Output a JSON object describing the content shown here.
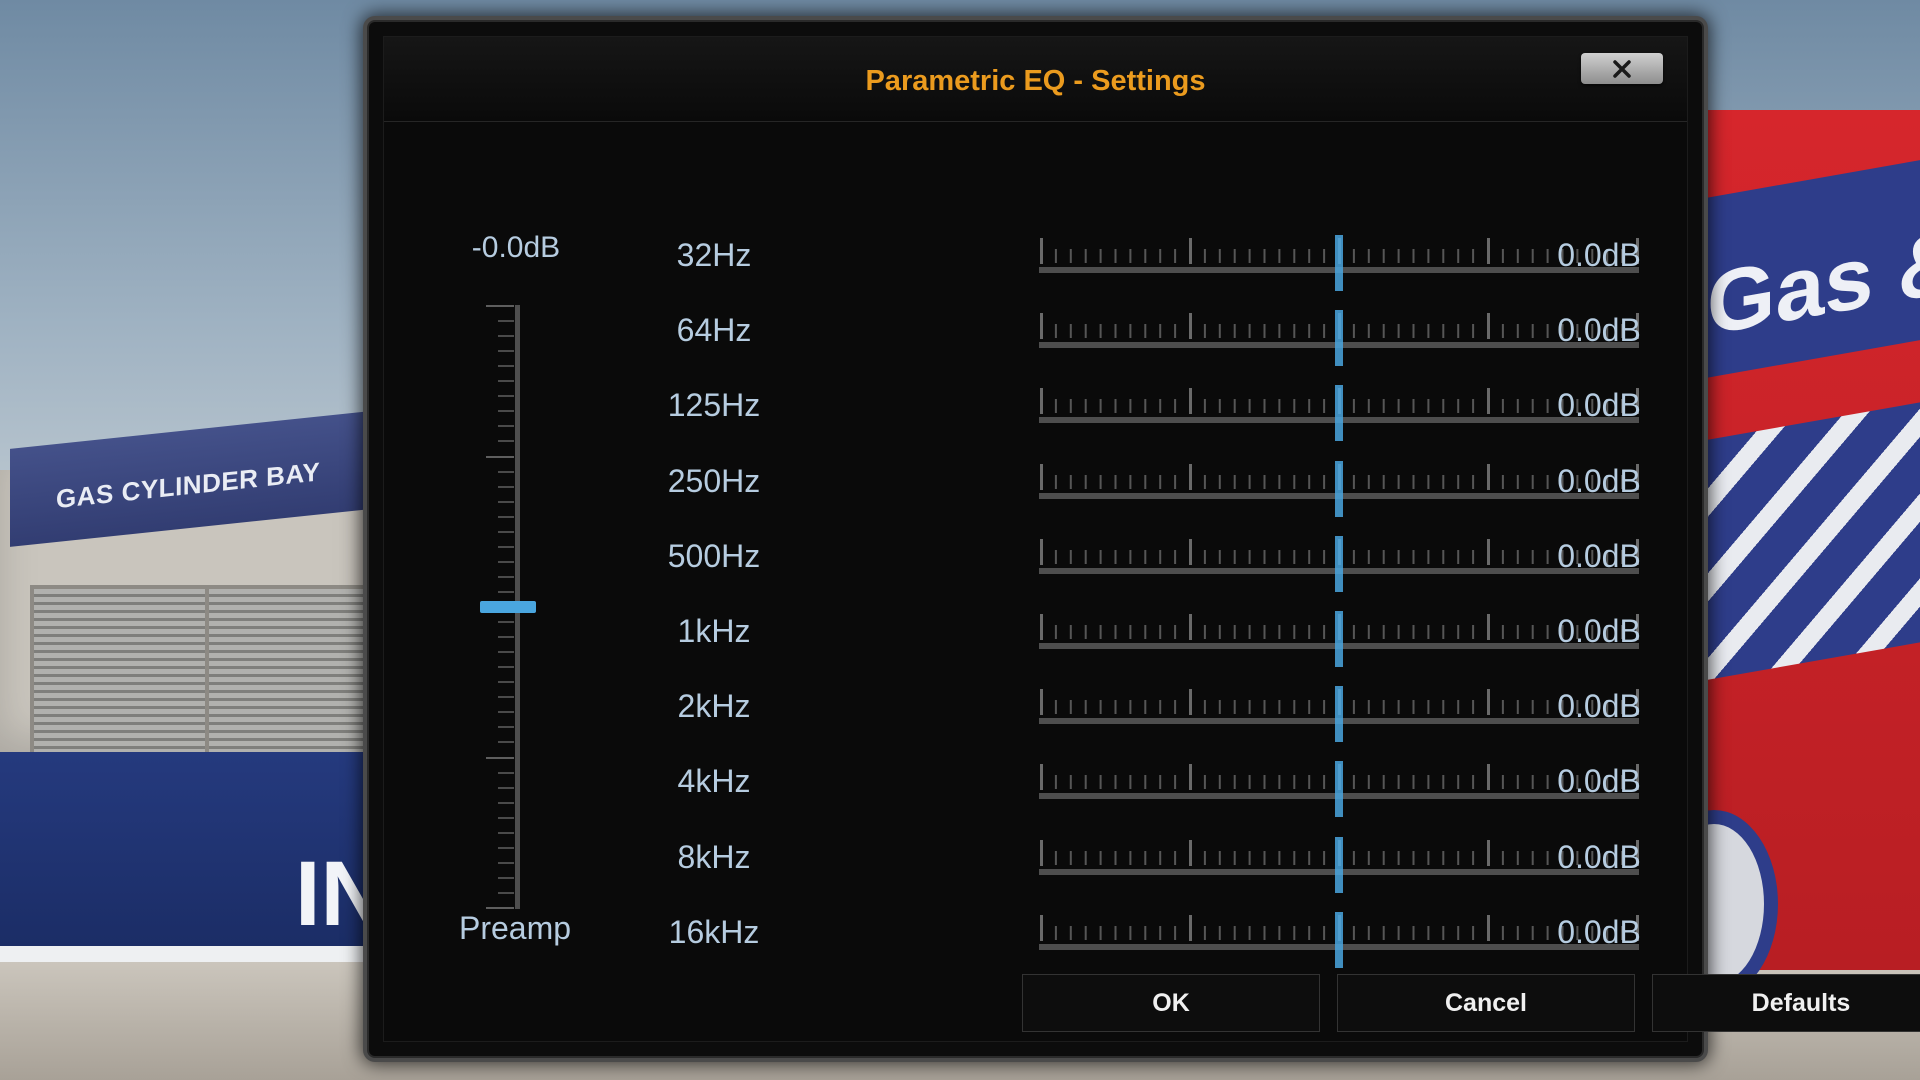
{
  "background": {
    "sign_left": "GAS CYLINDER BAY",
    "wall_text": "IN",
    "sign_right": "Gas &"
  },
  "dialog": {
    "title": "Parametric EQ - Settings",
    "close_icon": "close-icon"
  },
  "preamp": {
    "value": "-0.0dB",
    "label": "Preamp",
    "level_fraction": 0.5
  },
  "bands": [
    {
      "freq": "32Hz",
      "gain": "0.0dB",
      "level_fraction": 0.5
    },
    {
      "freq": "64Hz",
      "gain": "0.0dB",
      "level_fraction": 0.5
    },
    {
      "freq": "125Hz",
      "gain": "0.0dB",
      "level_fraction": 0.5
    },
    {
      "freq": "250Hz",
      "gain": "0.0dB",
      "level_fraction": 0.5
    },
    {
      "freq": "500Hz",
      "gain": "0.0dB",
      "level_fraction": 0.5
    },
    {
      "freq": "1kHz",
      "gain": "0.0dB",
      "level_fraction": 0.5
    },
    {
      "freq": "2kHz",
      "gain": "0.0dB",
      "level_fraction": 0.5
    },
    {
      "freq": "4kHz",
      "gain": "0.0dB",
      "level_fraction": 0.5
    },
    {
      "freq": "8kHz",
      "gain": "0.0dB",
      "level_fraction": 0.5
    },
    {
      "freq": "16kHz",
      "gain": "0.0dB",
      "level_fraction": 0.5
    }
  ],
  "buttons": {
    "ok": "OK",
    "cancel": "Cancel",
    "defaults": "Defaults"
  },
  "colors": {
    "title": "#eb9b1e",
    "label": "#b6cce0",
    "accent": "#4aa6df",
    "dialog_bg": "#0a0a0a"
  }
}
